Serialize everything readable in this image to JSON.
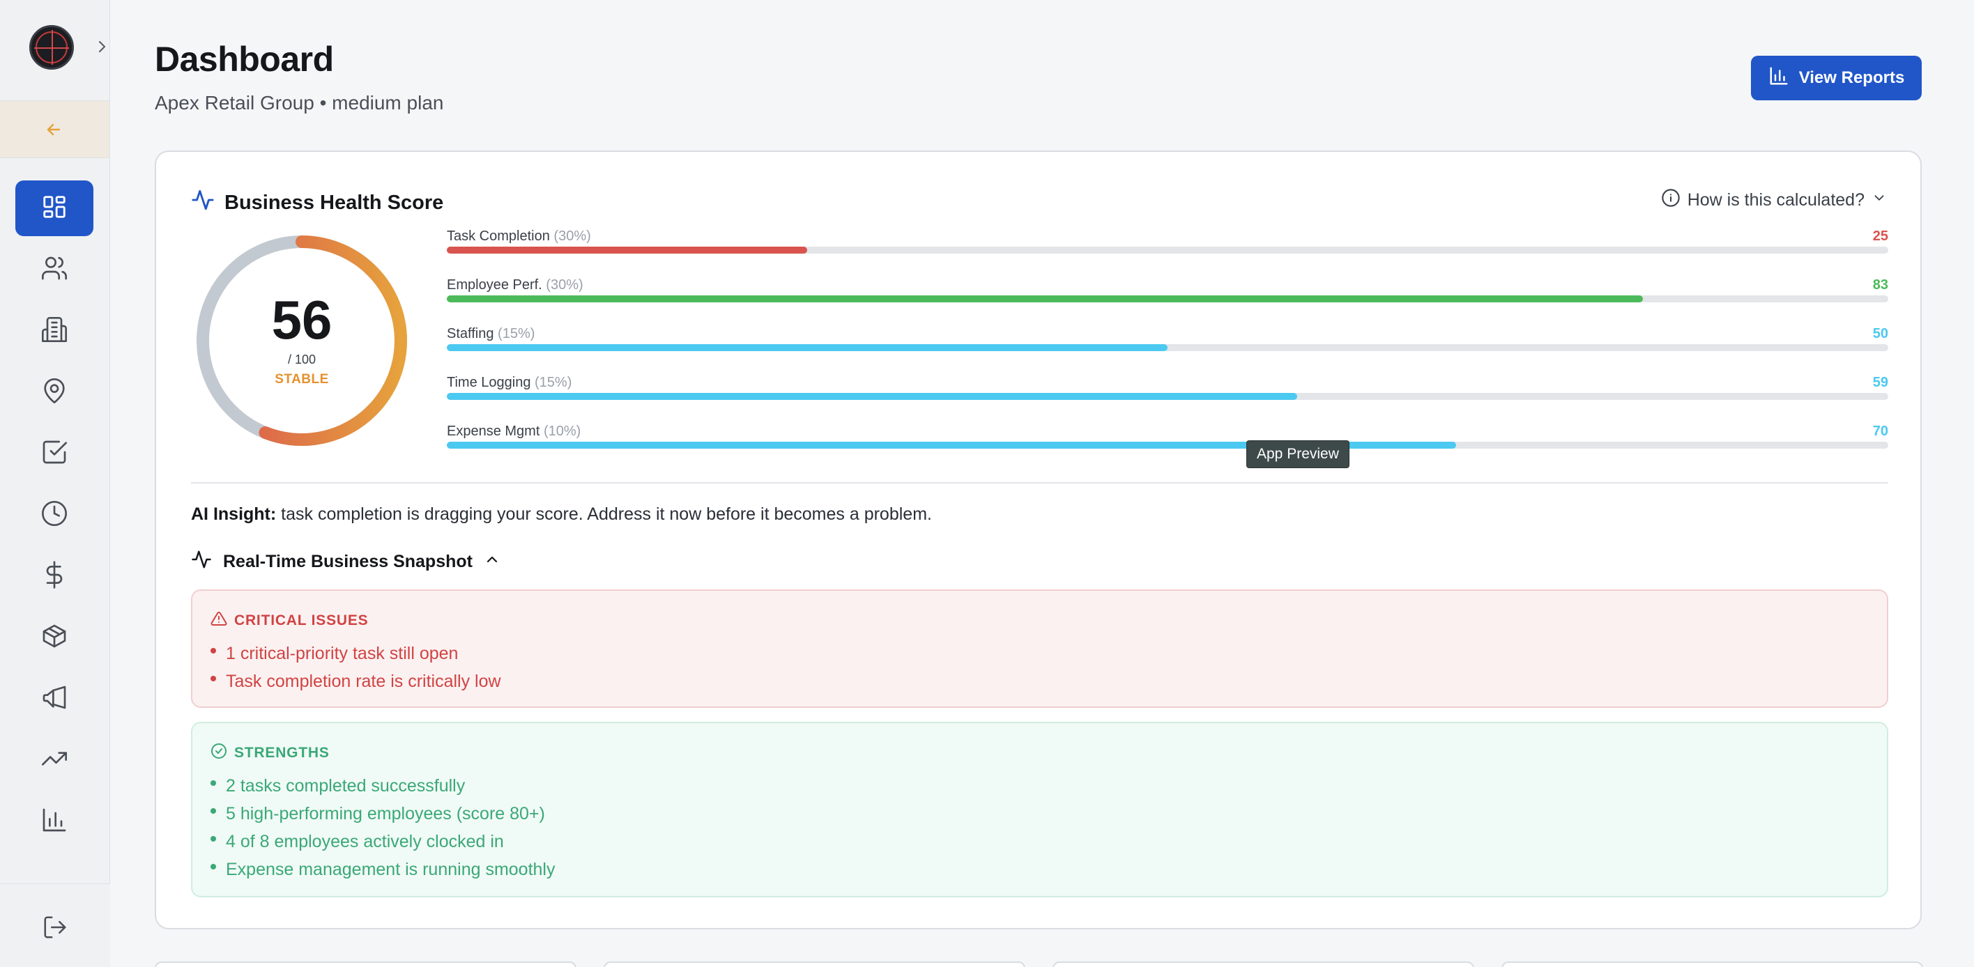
{
  "header": {
    "title": "Dashboard",
    "company": "Apex Retail Group",
    "separator": "•",
    "plan": "medium plan",
    "view_reports_label": "View Reports"
  },
  "sidebar": {
    "items": [
      {
        "icon": "dashboard-icon",
        "active": true
      },
      {
        "icon": "users-icon"
      },
      {
        "icon": "building-icon"
      },
      {
        "icon": "map-pin-icon"
      },
      {
        "icon": "check-square-icon"
      },
      {
        "icon": "clock-icon"
      },
      {
        "icon": "dollar-icon"
      },
      {
        "icon": "package-icon"
      },
      {
        "icon": "megaphone-icon"
      },
      {
        "icon": "trending-up-icon"
      },
      {
        "icon": "bar-chart-icon"
      }
    ],
    "colors": {
      "active": "#2156c9",
      "back_arrow": "#e6a23c"
    }
  },
  "health": {
    "title": "Business Health Score",
    "how_calculated": "How is this calculated?",
    "score": "56",
    "max": "/ 100",
    "status": "STABLE",
    "metrics": [
      {
        "label": "Task Completion",
        "weight": "(30%)",
        "value": "25",
        "color": "#d9534f"
      },
      {
        "label": "Employee Perf.",
        "weight": "(30%)",
        "value": "83",
        "color": "#4cba5a"
      },
      {
        "label": "Staffing",
        "weight": "(15%)",
        "value": "50",
        "color": "#4cc9f0"
      },
      {
        "label": "Time Logging",
        "weight": "(15%)",
        "value": "59",
        "color": "#4cc9f0"
      },
      {
        "label": "Expense Mgmt",
        "weight": "(10%)",
        "value": "70",
        "color": "#4cc9f0"
      }
    ],
    "tooltip": "App Preview"
  },
  "insight": {
    "label": "AI Insight:",
    "text": "task completion is dragging your score. Address it now before it becomes a problem."
  },
  "snapshot": {
    "title": "Real-Time Business Snapshot",
    "critical": {
      "heading": "CRITICAL ISSUES",
      "items": [
        "1 critical-priority task still open",
        "Task completion rate is critically low"
      ]
    },
    "strengths": {
      "heading": "STRENGTHS",
      "items": [
        "2 tasks completed successfully",
        "5 high-performing employees (score 80+)",
        "4 of 8 employees actively clocked in",
        "Expense management is running smoothly"
      ]
    }
  }
}
